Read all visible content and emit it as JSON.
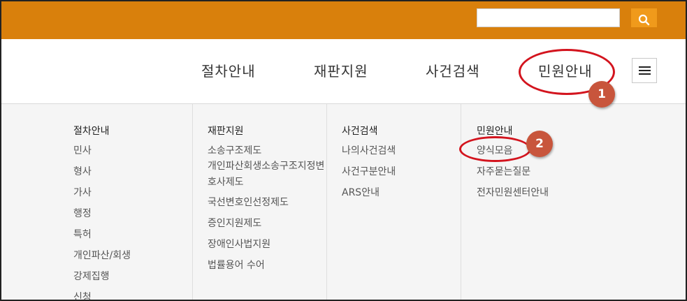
{
  "header": {
    "search_placeholder": "",
    "accent_color": "#d9800c",
    "search_button_icon": "search-icon"
  },
  "nav": {
    "items": [
      "절차안내",
      "재판지원",
      "사건검색",
      "민원안내"
    ],
    "menu_icon": "hamburger-menu-icon"
  },
  "mega_menu": {
    "columns": [
      {
        "title": "절차안내",
        "items": [
          "민사",
          "형사",
          "가사",
          "행정",
          "특허",
          "개인파산/회생",
          "강제집행",
          "신청"
        ]
      },
      {
        "title": "재판지원",
        "items": [
          "소송구조제도",
          "개인파산회생소송구조지정변호사제도",
          "국선변호인선정제도",
          "증인지원제도",
          "장애인사법지원",
          "법률용어 수어"
        ]
      },
      {
        "title": "사건검색",
        "items": [
          "나의사건검색",
          "사건구분안내",
          "ARS안내"
        ]
      },
      {
        "title": "민원안내",
        "items": [
          "양식모음",
          "자주묻는질문",
          "전자민원센터안내"
        ]
      }
    ]
  },
  "annotations": {
    "step1": "1",
    "step2": "2",
    "color": "#d3141e"
  }
}
